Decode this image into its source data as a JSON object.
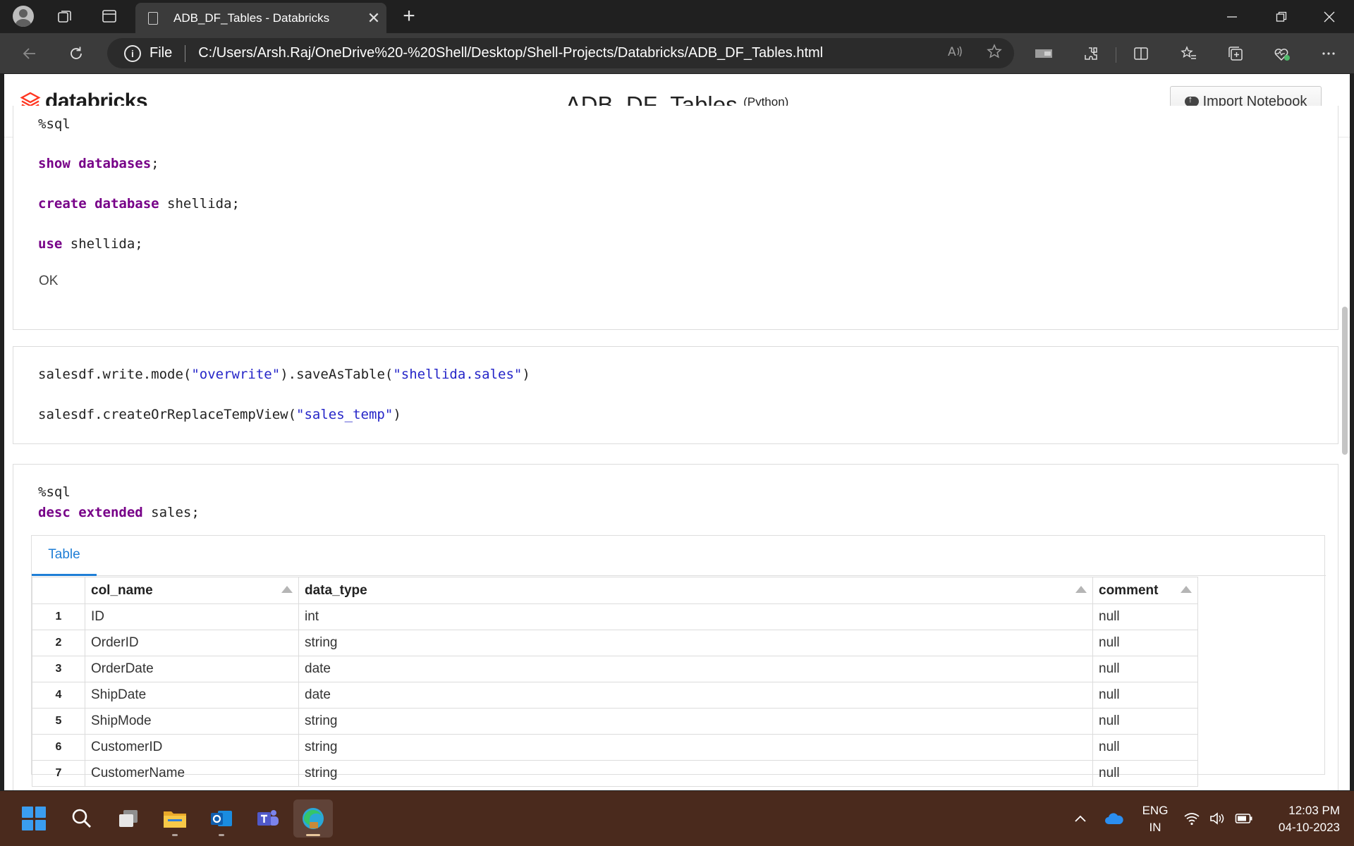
{
  "browser": {
    "tab_title": "ADB_DF_Tables - Databricks",
    "close_glyph": "✕",
    "newtab_glyph": "+",
    "scheme": "File",
    "url": "C:/Users/Arsh.Raj/OneDrive%20-%20Shell/Desktop/Shell-Projects/Databricks/ADB_DF_Tables.html"
  },
  "header": {
    "logo_text": "databricks",
    "notebook_name": "ADB_DF_Tables",
    "notebook_lang": "(Python)",
    "import_label": "Import Notebook"
  },
  "cells": {
    "c1": {
      "magic": "%sql",
      "l1_kw": "show databases",
      "l1_rest": ";",
      "l2_kw": "create database",
      "l2_rest": " shellida;",
      "l3_kw": "use",
      "l3_rest": " shellida;",
      "output": "OK"
    },
    "c2": {
      "l1_a": "salesdf.write.mode(",
      "l1_s1": "\"overwrite\"",
      "l1_b": ").saveAsTable(",
      "l1_s2": "\"shellida.sales\"",
      "l1_c": ")",
      "l2_a": "salesdf.createOrReplaceTempView(",
      "l2_s": "\"sales_temp\"",
      "l2_b": ")"
    },
    "c3": {
      "magic": "%sql",
      "kw": "desc extended",
      "rest": " sales;",
      "result_tab": "Table",
      "columns": [
        "col_name",
        "data_type",
        "comment"
      ],
      "rows": [
        {
          "idx": "1",
          "col_name": "ID",
          "data_type": "int",
          "comment": "null"
        },
        {
          "idx": "2",
          "col_name": "OrderID",
          "data_type": "string",
          "comment": "null"
        },
        {
          "idx": "3",
          "col_name": "OrderDate",
          "data_type": "date",
          "comment": "null"
        },
        {
          "idx": "4",
          "col_name": "ShipDate",
          "data_type": "date",
          "comment": "null"
        },
        {
          "idx": "5",
          "col_name": "ShipMode",
          "data_type": "string",
          "comment": "null"
        },
        {
          "idx": "6",
          "col_name": "CustomerID",
          "data_type": "string",
          "comment": "null"
        },
        {
          "idx": "7",
          "col_name": "CustomerName",
          "data_type": "string",
          "comment": "null"
        }
      ]
    }
  },
  "tray": {
    "lang_line1": "ENG",
    "lang_line2": "IN",
    "time": "12:03 PM",
    "date": "04-10-2023"
  },
  "colors": {
    "keyword": "#770088",
    "string": "#2525c8",
    "accent": "#1f7ed6",
    "taskbar": "#4a2a1d"
  }
}
